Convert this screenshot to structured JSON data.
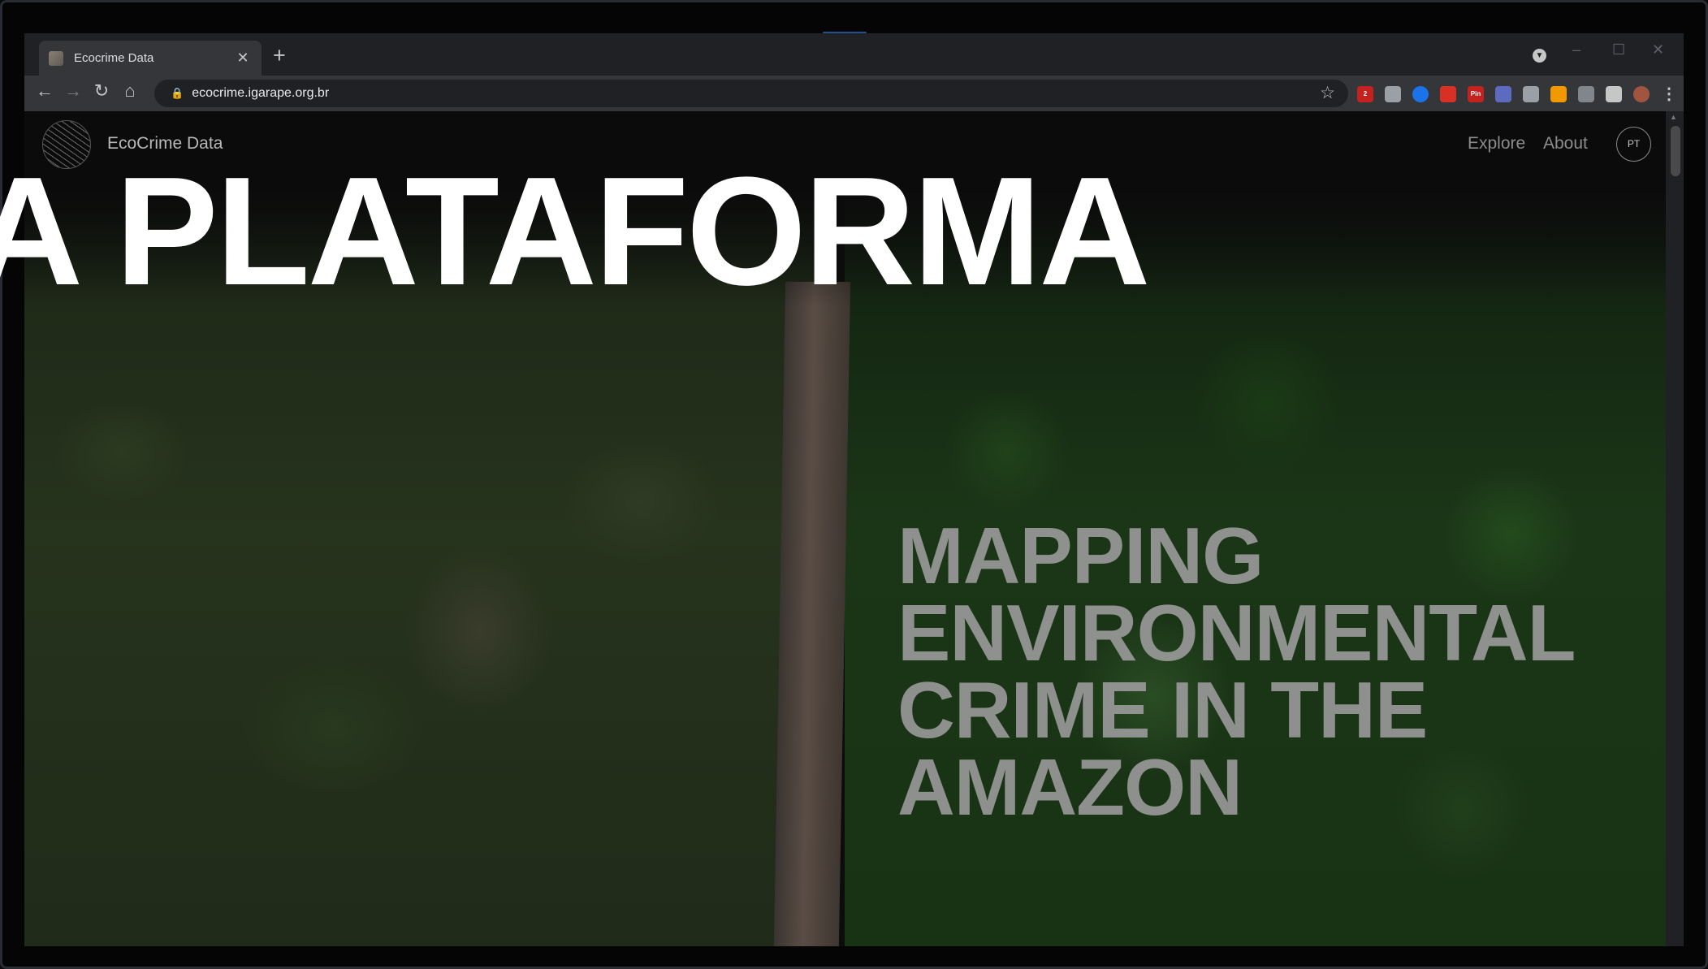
{
  "browser": {
    "tab_title": "Ecocrime Data",
    "tab_close": "✕",
    "new_tab": "+",
    "url": "ecocrime.igarape.org.br",
    "nav": {
      "back": "←",
      "forward": "→",
      "reload": "↻",
      "home": "⌂"
    },
    "star": "☆",
    "window_controls": {
      "minimize": "–",
      "maximize": "☐",
      "close": "✕"
    },
    "extensions": [
      {
        "name": "extension-badge-icon",
        "text": "2",
        "color": "#c5221f"
      },
      {
        "name": "extension-pen-icon",
        "text": "",
        "color": "#9aa0a6"
      },
      {
        "name": "extension-blue-icon",
        "text": "",
        "color": "#1a73e8"
      },
      {
        "name": "extension-red-hand-icon",
        "text": "",
        "color": "#d93025"
      },
      {
        "name": "extension-pin-icon",
        "text": "Pin",
        "color": "#c5221f"
      },
      {
        "name": "extension-screen-icon",
        "text": "",
        "color": "#5c6bc0"
      },
      {
        "name": "extension-eye-icon",
        "text": "",
        "color": "#9aa0a6"
      },
      {
        "name": "extension-flag-icon",
        "text": "",
        "color": "#f29900"
      },
      {
        "name": "extension-gray-icon",
        "text": "",
        "color": "#80868b"
      },
      {
        "name": "extensions-puzzle-icon",
        "text": "",
        "color": "#c4c7c5"
      },
      {
        "name": "profile-avatar-icon",
        "text": "",
        "color": "#a1553f"
      },
      {
        "name": "browser-menu-icon",
        "text": "⋮",
        "color": "#35363a"
      }
    ]
  },
  "site": {
    "brand": "EcoCrime Data",
    "nav": {
      "explore": "Explore",
      "about": "About"
    },
    "lang_button": "PT",
    "hero_title": "MAPPING ENVIRONMENTAL CRIME IN THE AMAZON"
  },
  "overlay_caption": "A PLATAFORMA"
}
